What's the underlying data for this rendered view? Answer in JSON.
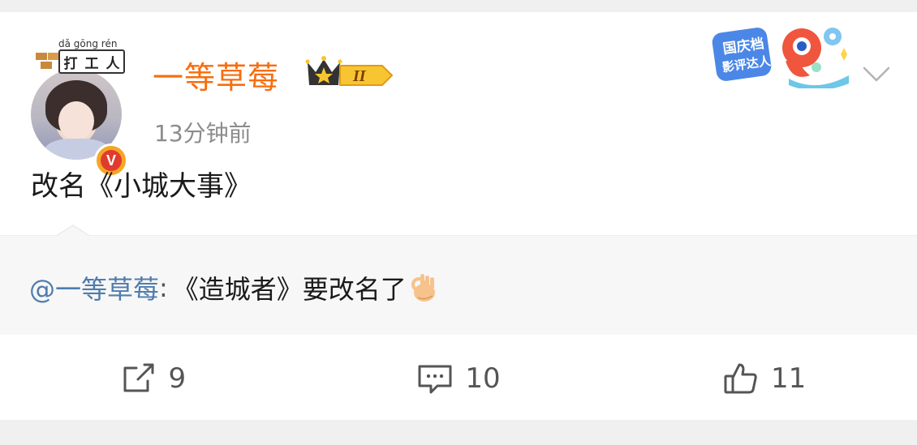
{
  "post": {
    "author": {
      "name": "一等草莓",
      "level_badge": "II",
      "pendant_pinyin": "dǎ gōng rén",
      "pendant_chars": [
        "打",
        "工",
        "人"
      ],
      "verified_badge": "V"
    },
    "timestamp": "13分钟前",
    "text": "改名《小城大事》",
    "right_pendant_text": [
      "国庆档",
      "影评达人"
    ]
  },
  "repost": {
    "mention": "@一等草莓",
    "separator": " :",
    "text": "《造城者》要改名了"
  },
  "actions": {
    "forward_count": "9",
    "comment_count": "10",
    "like_count": "11"
  },
  "colors": {
    "username": "#f86d0c",
    "mention": "#4f7cae",
    "timestamp": "#8c8c8c",
    "background": "#f0f0f0"
  },
  "icons": [
    "share-icon",
    "comment-icon",
    "thumbs-up-icon",
    "chevron-down-icon",
    "ok-hand-emoji",
    "crown-icon",
    "verified-icon"
  ]
}
